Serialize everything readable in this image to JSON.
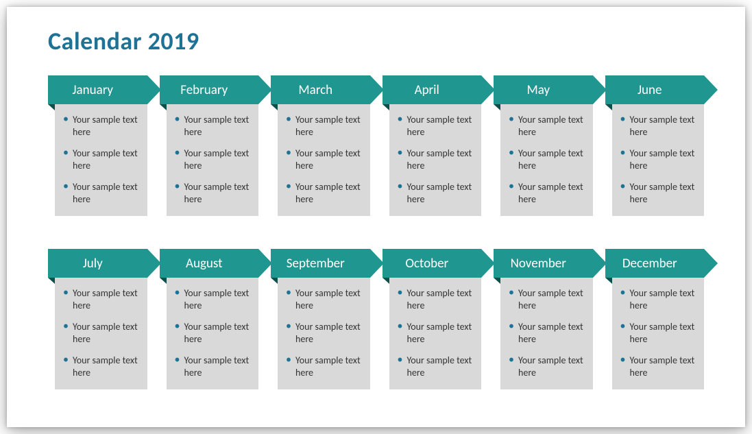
{
  "title": "Calendar 2019",
  "colors": {
    "title": "#1e7295",
    "banner": "#209690",
    "banner_fold": "#0e4f4b",
    "card_bg": "#d9d9d9",
    "bullet": "#1e7295"
  },
  "months": [
    {
      "name": "January",
      "items": [
        "Your sample text here",
        "Your sample text here",
        "Your sample text here"
      ]
    },
    {
      "name": "February",
      "items": [
        "Your sample text here",
        "Your sample text here",
        "Your sample text here"
      ]
    },
    {
      "name": "March",
      "items": [
        "Your sample text here",
        "Your sample text here",
        "Your sample text here"
      ]
    },
    {
      "name": "April",
      "items": [
        "Your sample text here",
        "Your sample text here",
        "Your sample text here"
      ]
    },
    {
      "name": "May",
      "items": [
        "Your sample text here",
        "Your sample text here",
        "Your sample text here"
      ]
    },
    {
      "name": "June",
      "items": [
        "Your sample text here",
        "Your sample text here",
        "Your sample text here"
      ]
    },
    {
      "name": "July",
      "items": [
        "Your sample text here",
        "Your sample text here",
        "Your sample text here"
      ]
    },
    {
      "name": "August",
      "items": [
        "Your sample text here",
        "Your sample text here",
        "Your sample text here"
      ]
    },
    {
      "name": "September",
      "items": [
        "Your sample text here",
        "Your sample text here",
        "Your sample text here"
      ]
    },
    {
      "name": "October",
      "items": [
        "Your sample text here",
        "Your sample text here",
        "Your sample text here"
      ]
    },
    {
      "name": "November",
      "items": [
        "Your sample text here",
        "Your sample text here",
        "Your sample text here"
      ]
    },
    {
      "name": "December",
      "items": [
        "Your sample text here",
        "Your sample text here",
        "Your sample text here"
      ]
    }
  ]
}
